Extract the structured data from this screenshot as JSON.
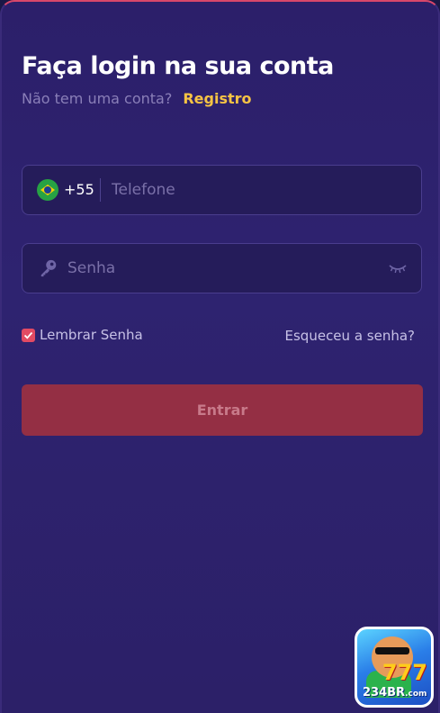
{
  "login": {
    "title": "Faça login na sua conta",
    "no_account_text": "Não tem uma conta?",
    "register_link": "Registro",
    "phone": {
      "flag": "brazil-flag-icon",
      "dial_code": "+55",
      "placeholder": "Telefone",
      "value": ""
    },
    "password": {
      "icon": "key-icon",
      "placeholder": "Senha",
      "value": "",
      "visibility_icon": "eye-closed-icon"
    },
    "remember": {
      "label": "Lembrar Senha",
      "checked": true
    },
    "forgot_link": "Esqueceu a senha?",
    "submit_label": "Entrar"
  },
  "app_badge": {
    "text": "234BR",
    "suffix": ".com",
    "number": "777"
  },
  "colors": {
    "background": "#2c2068",
    "accent_link": "#f6c344",
    "button": "#942f44",
    "checkbox": "#e24a63",
    "top_border": "#d8476a"
  }
}
